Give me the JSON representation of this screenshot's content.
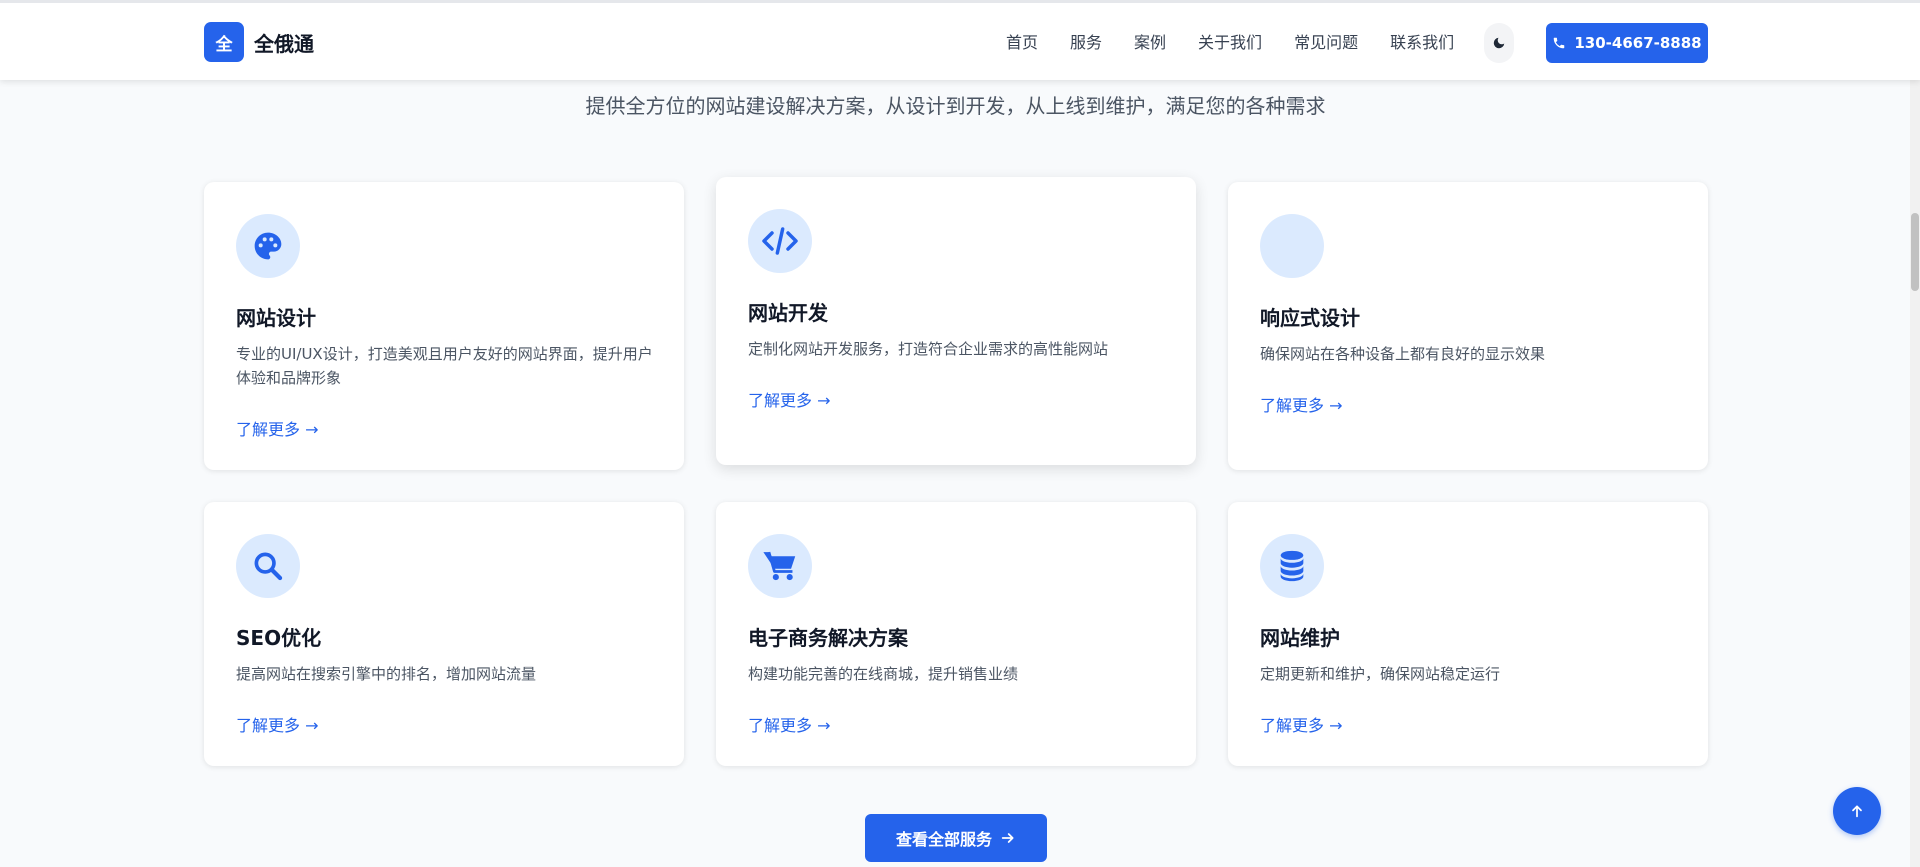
{
  "header": {
    "logo_char": "全",
    "brand_name": "全俄通",
    "nav": [
      "首页",
      "服务",
      "案例",
      "关于我们",
      "常见问题",
      "联系我们"
    ],
    "theme_icon": "moon-icon",
    "phone": "130-4667-8888"
  },
  "section": {
    "subtitle": "提供全方位的网站建设解决方案，从设计到开发，从上线到维护，满足您的各种需求"
  },
  "services": [
    {
      "icon": "palette-icon",
      "title": "网站设计",
      "desc": "专业的UI/UX设计，打造美观且用户友好的网站界面，提升用户体验和品牌形象",
      "link": "了解更多 →"
    },
    {
      "icon": "code-icon",
      "title": "网站开发",
      "desc": "定制化网站开发服务，打造符合企业需求的高性能网站",
      "link": "了解更多 →"
    },
    {
      "icon": "mobile-icon",
      "title": "响应式设计",
      "desc": "确保网站在各种设备上都有良好的显示效果",
      "link": "了解更多 →"
    },
    {
      "icon": "search-icon",
      "title": "SEO优化",
      "desc": "提高网站在搜索引擎中的排名，增加网站流量",
      "link": "了解更多 →"
    },
    {
      "icon": "cart-icon",
      "title": "电子商务解决方案",
      "desc": "构建功能完善的在线商城，提升销售业绩",
      "link": "了解更多 →"
    },
    {
      "icon": "database-icon",
      "title": "网站维护",
      "desc": "定期更新和维护，确保网站稳定运行",
      "link": "了解更多 →"
    }
  ],
  "view_all_label": "查看全部服务",
  "colors": {
    "primary": "#2563eb",
    "icon_bg": "#dbeafe",
    "page_bg": "#f8fafc"
  }
}
